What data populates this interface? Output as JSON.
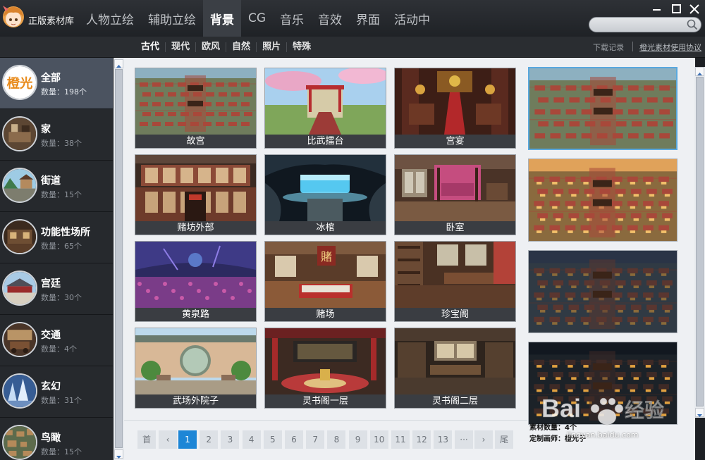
{
  "app": {
    "title": "正版素材库",
    "logo_icon": "anime-girl-logo-icon"
  },
  "main_nav": [
    {
      "label": "人物立绘",
      "active": false
    },
    {
      "label": "辅助立绘",
      "active": false
    },
    {
      "label": "背景",
      "active": true
    },
    {
      "label": "CG",
      "active": false
    },
    {
      "label": "音乐",
      "active": false
    },
    {
      "label": "音效",
      "active": false
    },
    {
      "label": "界面",
      "active": false
    },
    {
      "label": "活动中",
      "active": false
    }
  ],
  "search": {
    "placeholder": "",
    "value": "",
    "icon": "search-icon"
  },
  "window_controls": [
    "minimize-icon",
    "maximize-icon",
    "close-icon"
  ],
  "sub_tabs": [
    {
      "label": "古代",
      "active": true
    },
    {
      "label": "现代",
      "active": false
    },
    {
      "label": "欧风",
      "active": false
    },
    {
      "label": "自然",
      "active": false
    },
    {
      "label": "照片",
      "active": false
    },
    {
      "label": "特殊",
      "active": false
    }
  ],
  "links": {
    "download": "下载记录",
    "license": "橙光素材使用协议"
  },
  "categories": [
    {
      "name": "全部",
      "count": "数量：198个",
      "active": true,
      "thumb_logo": "橙光"
    },
    {
      "name": "家",
      "count": "数量：38个",
      "active": false
    },
    {
      "name": "街道",
      "count": "数量：15个",
      "active": false
    },
    {
      "name": "功能性场所",
      "count": "数量：65个",
      "active": false
    },
    {
      "name": "宫廷",
      "count": "数量：30个",
      "active": false
    },
    {
      "name": "交通",
      "count": "数量：4个",
      "active": false
    },
    {
      "name": "玄幻",
      "count": "数量：31个",
      "active": false
    },
    {
      "name": "鸟瞰",
      "count": "数量：15个",
      "active": false
    }
  ],
  "tiles": [
    {
      "label": "故宫",
      "palette": "palace"
    },
    {
      "label": "比武擂台",
      "palette": "arena"
    },
    {
      "label": "宫宴",
      "palette": "banquet"
    },
    {
      "label": "赌坊外部",
      "palette": "exterior"
    },
    {
      "label": "冰棺",
      "palette": "ice"
    },
    {
      "label": "卧室",
      "palette": "bedroom"
    },
    {
      "label": "黄泉路",
      "palette": "underworld"
    },
    {
      "label": "赌场",
      "palette": "casino"
    },
    {
      "label": "珍宝阁",
      "palette": "treasury"
    },
    {
      "label": "武场外院子",
      "palette": "courtyard"
    },
    {
      "label": "灵书阁一层",
      "palette": "library1"
    },
    {
      "label": "灵书阁二层",
      "palette": "library2"
    }
  ],
  "pagination": {
    "first": "首",
    "prev": "‹",
    "pages": [
      "1",
      "2",
      "3",
      "4",
      "5",
      "6",
      "7",
      "8",
      "9",
      "10",
      "11",
      "12",
      "13"
    ],
    "ellipsis": "···",
    "next": "›",
    "last": "尾",
    "current": "1"
  },
  "preview": {
    "variants": [
      "day",
      "sunset",
      "dusk",
      "night"
    ],
    "selected": "day",
    "count_text": "素材数量：4个",
    "order_text": "定制画师：橙光子"
  },
  "watermark": {
    "text": "Bai经验",
    "url": "jingyan.baidu.com"
  }
}
